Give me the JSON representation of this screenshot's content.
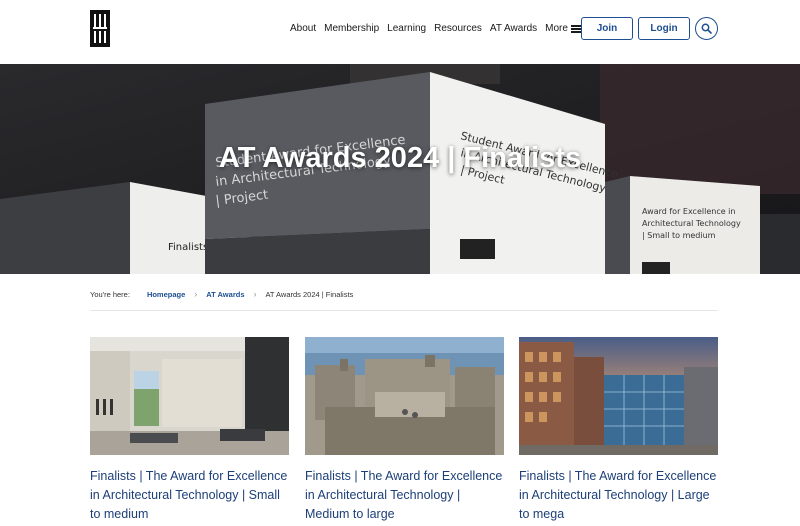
{
  "header": {
    "nav": [
      "About",
      "Membership",
      "Learning",
      "Resources",
      "AT Awards"
    ],
    "more_label": "More",
    "join_label": "Join",
    "login_label": "Login"
  },
  "hero": {
    "title": "AT Awards 2024 | Finalists"
  },
  "breadcrumb": {
    "prefix": "You're here:",
    "items": [
      "Homepage",
      "AT Awards"
    ],
    "current": "AT Awards 2024 | Finalists"
  },
  "cards": [
    {
      "title": "Finalists | The Award for Excellence in Architectural Technology | Small to medium"
    },
    {
      "title": "Finalists | The Award for Excellence in Architectural Technology | Medium to large"
    },
    {
      "title": "Finalists | The Award for Excellence in Architectural Technology | Large to mega"
    }
  ],
  "colors": {
    "accent": "#1d4f91",
    "card_title": "#1d3f78"
  }
}
